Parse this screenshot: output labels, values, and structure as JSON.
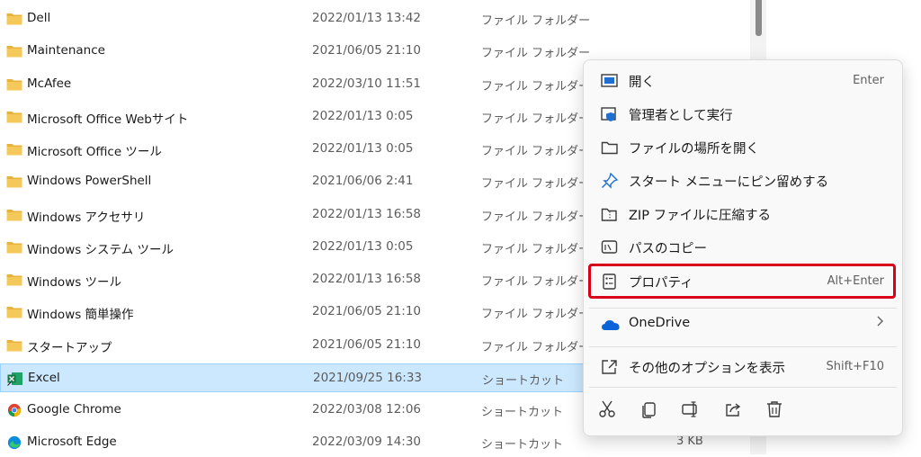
{
  "files": [
    {
      "name": "Dell",
      "date": "2022/01/13 13:42",
      "type": "ファイル フォルダー",
      "size": "",
      "icon": "folder-icon"
    },
    {
      "name": "Maintenance",
      "date": "2021/06/05 21:10",
      "type": "ファイル フォルダー",
      "size": "",
      "icon": "folder-icon"
    },
    {
      "name": "McAfee",
      "date": "2022/03/10 11:51",
      "type": "ファイル フォルダー",
      "size": "",
      "icon": "folder-icon"
    },
    {
      "name": "Microsoft Office Webサイト",
      "date": "2022/01/13 0:05",
      "type": "ファイル フォルダー",
      "size": "",
      "icon": "folder-icon"
    },
    {
      "name": "Microsoft Office ツール",
      "date": "2022/01/13 0:05",
      "type": "ファイル フォルダー",
      "size": "",
      "icon": "folder-icon"
    },
    {
      "name": "Windows PowerShell",
      "date": "2021/06/06 2:41",
      "type": "ファイル フォルダー",
      "size": "",
      "icon": "folder-icon"
    },
    {
      "name": "Windows アクセサリ",
      "date": "2022/01/13 16:58",
      "type": "ファイル フォルダー",
      "size": "",
      "icon": "folder-icon"
    },
    {
      "name": "Windows システム ツール",
      "date": "2022/01/13 0:05",
      "type": "ファイル フォルダー",
      "size": "",
      "icon": "folder-icon"
    },
    {
      "name": "Windows ツール",
      "date": "2022/01/13 16:58",
      "type": "ファイル フォルダー",
      "size": "",
      "icon": "folder-icon"
    },
    {
      "name": "Windows 簡単操作",
      "date": "2021/06/05 21:10",
      "type": "ファイル フォルダー",
      "size": "",
      "icon": "folder-icon"
    },
    {
      "name": "スタートアップ",
      "date": "2021/06/05 21:10",
      "type": "ファイル フォルダー",
      "size": "",
      "icon": "folder-icon"
    },
    {
      "name": "Excel",
      "date": "2021/09/25 16:33",
      "type": "ショートカット",
      "size": "",
      "icon": "excel-icon",
      "selected": true
    },
    {
      "name": "Google Chrome",
      "date": "2022/03/08 12:06",
      "type": "ショートカット",
      "size": "",
      "icon": "chrome-icon"
    },
    {
      "name": "Microsoft Edge",
      "date": "2022/03/09 14:30",
      "type": "ショートカット",
      "size": "3 KB",
      "icon": "edge-icon"
    }
  ],
  "context_menu": {
    "items": [
      {
        "label": "開く",
        "shortcut": "Enter",
        "icon": "open-window-icon"
      },
      {
        "label": "管理者として実行",
        "shortcut": "",
        "icon": "shield-icon"
      },
      {
        "label": "ファイルの場所を開く",
        "shortcut": "",
        "icon": "folder-outline-icon"
      },
      {
        "label": "スタート メニューにピン留めする",
        "shortcut": "",
        "icon": "pin-icon"
      },
      {
        "label": "ZIP ファイルに圧縮する",
        "shortcut": "",
        "icon": "zip-icon"
      },
      {
        "label": "パスのコピー",
        "shortcut": "",
        "icon": "copy-path-icon"
      },
      {
        "label": "プロパティ",
        "shortcut": "Alt+Enter",
        "icon": "properties-icon",
        "highlighted": true
      }
    ],
    "onedrive": {
      "label": "OneDrive",
      "icon": "onedrive-icon"
    },
    "more_options": {
      "label": "その他のオプションを表示",
      "shortcut": "Shift+F10",
      "icon": "more-options-icon"
    },
    "quick_actions": [
      "cut-icon",
      "copy-icon",
      "rename-icon",
      "share-icon",
      "delete-icon"
    ]
  },
  "colors": {
    "selection": "#cce8ff",
    "highlight_border": "#d9001b",
    "folder": "#f2c14e",
    "onedrive": "#0a64d8"
  }
}
